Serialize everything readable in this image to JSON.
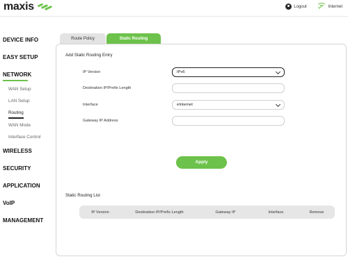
{
  "header": {
    "brand": "maxis",
    "logout_label": "Logout",
    "internet_label": "Internet",
    "accent_color": "#6cc24a"
  },
  "sidebar": {
    "items": [
      {
        "label": "DEVICE INFO"
      },
      {
        "label": "EASY SETUP"
      },
      {
        "label": "NETWORK",
        "active": true
      },
      {
        "label": "WAN Setup"
      },
      {
        "label": "LAN Setup"
      },
      {
        "label": "Routing",
        "active": true
      },
      {
        "label": "WAN Mode"
      },
      {
        "label": "Interface Control"
      },
      {
        "label": "WIRELESS"
      },
      {
        "label": "SECURITY"
      },
      {
        "label": "APPLICATION"
      },
      {
        "label": "VoIP"
      },
      {
        "label": "MANAGEMENT"
      }
    ]
  },
  "tabs": [
    {
      "label": "Route Policy",
      "active": false
    },
    {
      "label": "Static Routing",
      "active": true
    }
  ],
  "form": {
    "title": "Add Static Routing Entry",
    "fields": {
      "ip_version": {
        "label": "IP Version",
        "value": "IPv6"
      },
      "destination": {
        "label": "Destination IP/Prefix Length",
        "value": ""
      },
      "interface": {
        "label": "Interface",
        "value": "eInternet"
      },
      "gateway": {
        "label": "Gateway IP Address",
        "value": ""
      }
    },
    "apply_label": "Apply"
  },
  "list": {
    "title": "Static Routing List",
    "columns": [
      "IP Version",
      "Destination IP/Prefix Length",
      "Gateway IP",
      "Interface",
      "Remove"
    ],
    "rows": []
  }
}
